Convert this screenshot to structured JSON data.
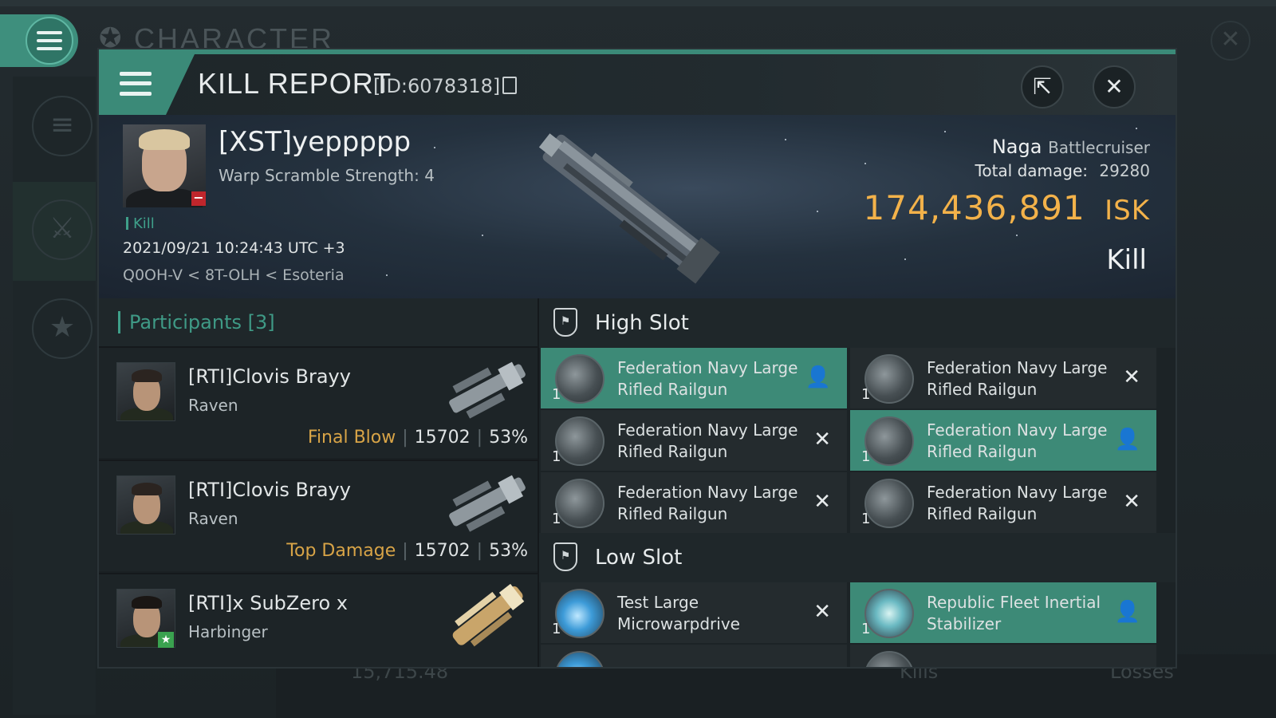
{
  "background": {
    "title": "CHARACTER",
    "bottom_value": "15,715.48",
    "bottom_kills": "Kills",
    "bottom_losses": "Losses"
  },
  "header": {
    "title": "KILL REPORT",
    "id": "[ID:6078318]"
  },
  "victim": {
    "name": "[XST]yeppppp",
    "warp_scramble": "Warp Scramble Strength: 4",
    "report_type_small": "Kill",
    "datetime": "2021/09/21 10:24:43 UTC +3",
    "location": "Q0OH-V < 8T-OLH < Esoteria",
    "ship": "Naga",
    "ship_class": "Battlecruiser",
    "total_damage_label": "Total damage:",
    "total_damage": "29280",
    "isk_value": "174,436,891",
    "isk_unit": "ISK",
    "report_type": "Kill"
  },
  "participants": {
    "label": "Participants",
    "count": "[3]",
    "rows": [
      {
        "name": "[RTI]Clovis Brayy",
        "ship": "Raven",
        "tag": "Final Blow",
        "damage": "15702",
        "percent": "53%"
      },
      {
        "name": "[RTI]Clovis Brayy",
        "ship": "Raven",
        "tag": "Top Damage",
        "damage": "15702",
        "percent": "53%"
      },
      {
        "name": "[RTI]x SubZero x",
        "ship": "Harbinger",
        "tag": "",
        "damage": "",
        "percent": ""
      }
    ]
  },
  "high_slot": {
    "label": "High Slot",
    "modules": [
      {
        "name": "Federation Navy Large Rifled Railgun",
        "qty": "1",
        "status": "dropped"
      },
      {
        "name": "Federation Navy Large Rifled Railgun",
        "qty": "1",
        "status": "destroyed"
      },
      {
        "name": "Federation Navy Large Rifled Railgun",
        "qty": "1",
        "status": "destroyed"
      },
      {
        "name": "Federation Navy Large Rifled Railgun",
        "qty": "1",
        "status": "dropped"
      },
      {
        "name": "Federation Navy Large Rifled Railgun",
        "qty": "1",
        "status": "destroyed"
      },
      {
        "name": "Federation Navy Large Rifled Railgun",
        "qty": "1",
        "status": "destroyed"
      }
    ]
  },
  "low_slot": {
    "label": "Low Slot",
    "modules": [
      {
        "name": "Test Large Microwarpdrive",
        "qty": "1",
        "status": "destroyed"
      },
      {
        "name": "Republic Fleet Inertial Stabilizer",
        "qty": "1",
        "status": "dropped"
      }
    ]
  },
  "icons": {
    "dropped": "person-icon",
    "destroyed": "x-icon"
  },
  "colors": {
    "accent": "#3b8a78",
    "isk": "#f3b24a",
    "tag": "#d8a447",
    "kill_badge": "#c0262c"
  }
}
